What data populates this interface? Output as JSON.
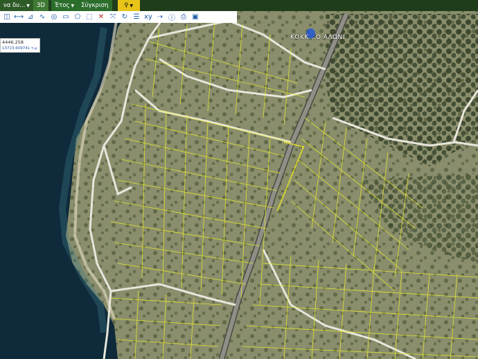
{
  "topbar": {
    "layer_label": "να δυ...",
    "mode_3d": "3D",
    "year_label": "Έτος",
    "compare_label": "Σύγκριση"
  },
  "toolbar": {
    "icons": [
      "layers-icon",
      "measure-line-icon",
      "measure-scale-icon",
      "polyline-icon",
      "circle-icon",
      "comment-icon",
      "polygon-icon",
      "select-icon",
      "clear-icon",
      "snap-icon",
      "refresh-icon",
      "report-icon",
      "xy-icon",
      "xy-goto-icon",
      "info-icon",
      "print-icon",
      "photo-icon"
    ]
  },
  "coordinates": {
    "line1": "4446.258",
    "line2": "13723.609741 τ.μ"
  },
  "map": {
    "place_label": "ΚΟΚΚ...Ο ΑΛΩΝΙ",
    "colors": {
      "sea": "#0f2a3a",
      "land": "#7d8565",
      "parcel": "#e8ec2a",
      "road": "#e8e6dc"
    }
  }
}
